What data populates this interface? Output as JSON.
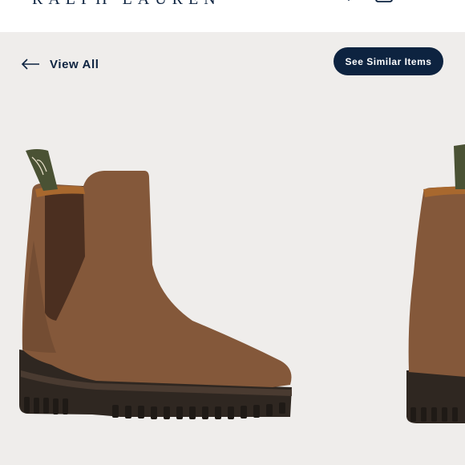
{
  "brand": {
    "logo_text": "RALPH LAUREN"
  },
  "header_icons": [
    "search-icon",
    "bag-icon",
    "menu-icon"
  ],
  "navigation": {
    "back_label": "View All"
  },
  "actions": {
    "similar_label": "See Similar Items"
  },
  "colors": {
    "navy": "#0d2340",
    "background": "#efedeb",
    "suede": "#84583a",
    "sole": "#3a3029"
  }
}
